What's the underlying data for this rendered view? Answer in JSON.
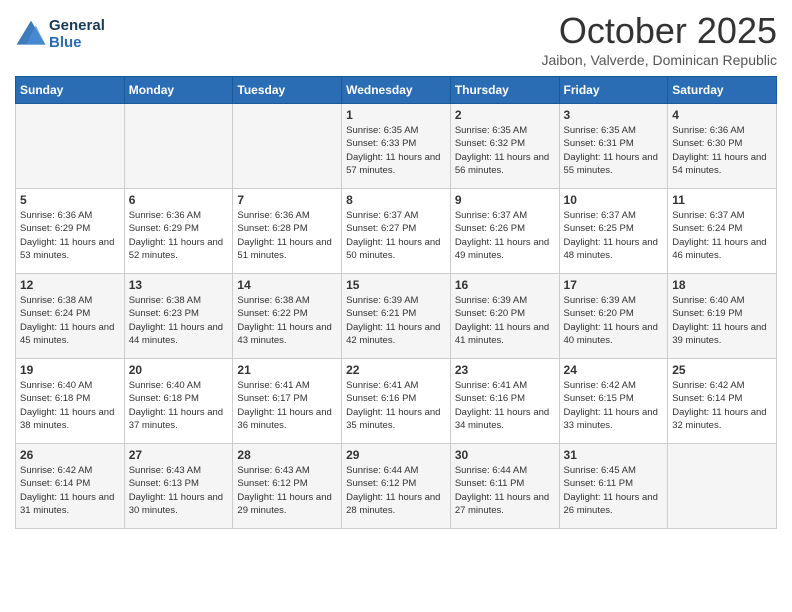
{
  "logo": {
    "line1": "General",
    "line2": "Blue"
  },
  "title": "October 2025",
  "location": "Jaibon, Valverde, Dominican Republic",
  "days_of_week": [
    "Sunday",
    "Monday",
    "Tuesday",
    "Wednesday",
    "Thursday",
    "Friday",
    "Saturday"
  ],
  "weeks": [
    [
      {
        "day": "",
        "sunrise": "",
        "sunset": "",
        "daylight": ""
      },
      {
        "day": "",
        "sunrise": "",
        "sunset": "",
        "daylight": ""
      },
      {
        "day": "",
        "sunrise": "",
        "sunset": "",
        "daylight": ""
      },
      {
        "day": "1",
        "sunrise": "Sunrise: 6:35 AM",
        "sunset": "Sunset: 6:33 PM",
        "daylight": "Daylight: 11 hours and 57 minutes."
      },
      {
        "day": "2",
        "sunrise": "Sunrise: 6:35 AM",
        "sunset": "Sunset: 6:32 PM",
        "daylight": "Daylight: 11 hours and 56 minutes."
      },
      {
        "day": "3",
        "sunrise": "Sunrise: 6:35 AM",
        "sunset": "Sunset: 6:31 PM",
        "daylight": "Daylight: 11 hours and 55 minutes."
      },
      {
        "day": "4",
        "sunrise": "Sunrise: 6:36 AM",
        "sunset": "Sunset: 6:30 PM",
        "daylight": "Daylight: 11 hours and 54 minutes."
      }
    ],
    [
      {
        "day": "5",
        "sunrise": "Sunrise: 6:36 AM",
        "sunset": "Sunset: 6:29 PM",
        "daylight": "Daylight: 11 hours and 53 minutes."
      },
      {
        "day": "6",
        "sunrise": "Sunrise: 6:36 AM",
        "sunset": "Sunset: 6:29 PM",
        "daylight": "Daylight: 11 hours and 52 minutes."
      },
      {
        "day": "7",
        "sunrise": "Sunrise: 6:36 AM",
        "sunset": "Sunset: 6:28 PM",
        "daylight": "Daylight: 11 hours and 51 minutes."
      },
      {
        "day": "8",
        "sunrise": "Sunrise: 6:37 AM",
        "sunset": "Sunset: 6:27 PM",
        "daylight": "Daylight: 11 hours and 50 minutes."
      },
      {
        "day": "9",
        "sunrise": "Sunrise: 6:37 AM",
        "sunset": "Sunset: 6:26 PM",
        "daylight": "Daylight: 11 hours and 49 minutes."
      },
      {
        "day": "10",
        "sunrise": "Sunrise: 6:37 AM",
        "sunset": "Sunset: 6:25 PM",
        "daylight": "Daylight: 11 hours and 48 minutes."
      },
      {
        "day": "11",
        "sunrise": "Sunrise: 6:37 AM",
        "sunset": "Sunset: 6:24 PM",
        "daylight": "Daylight: 11 hours and 46 minutes."
      }
    ],
    [
      {
        "day": "12",
        "sunrise": "Sunrise: 6:38 AM",
        "sunset": "Sunset: 6:24 PM",
        "daylight": "Daylight: 11 hours and 45 minutes."
      },
      {
        "day": "13",
        "sunrise": "Sunrise: 6:38 AM",
        "sunset": "Sunset: 6:23 PM",
        "daylight": "Daylight: 11 hours and 44 minutes."
      },
      {
        "day": "14",
        "sunrise": "Sunrise: 6:38 AM",
        "sunset": "Sunset: 6:22 PM",
        "daylight": "Daylight: 11 hours and 43 minutes."
      },
      {
        "day": "15",
        "sunrise": "Sunrise: 6:39 AM",
        "sunset": "Sunset: 6:21 PM",
        "daylight": "Daylight: 11 hours and 42 minutes."
      },
      {
        "day": "16",
        "sunrise": "Sunrise: 6:39 AM",
        "sunset": "Sunset: 6:20 PM",
        "daylight": "Daylight: 11 hours and 41 minutes."
      },
      {
        "day": "17",
        "sunrise": "Sunrise: 6:39 AM",
        "sunset": "Sunset: 6:20 PM",
        "daylight": "Daylight: 11 hours and 40 minutes."
      },
      {
        "day": "18",
        "sunrise": "Sunrise: 6:40 AM",
        "sunset": "Sunset: 6:19 PM",
        "daylight": "Daylight: 11 hours and 39 minutes."
      }
    ],
    [
      {
        "day": "19",
        "sunrise": "Sunrise: 6:40 AM",
        "sunset": "Sunset: 6:18 PM",
        "daylight": "Daylight: 11 hours and 38 minutes."
      },
      {
        "day": "20",
        "sunrise": "Sunrise: 6:40 AM",
        "sunset": "Sunset: 6:18 PM",
        "daylight": "Daylight: 11 hours and 37 minutes."
      },
      {
        "day": "21",
        "sunrise": "Sunrise: 6:41 AM",
        "sunset": "Sunset: 6:17 PM",
        "daylight": "Daylight: 11 hours and 36 minutes."
      },
      {
        "day": "22",
        "sunrise": "Sunrise: 6:41 AM",
        "sunset": "Sunset: 6:16 PM",
        "daylight": "Daylight: 11 hours and 35 minutes."
      },
      {
        "day": "23",
        "sunrise": "Sunrise: 6:41 AM",
        "sunset": "Sunset: 6:16 PM",
        "daylight": "Daylight: 11 hours and 34 minutes."
      },
      {
        "day": "24",
        "sunrise": "Sunrise: 6:42 AM",
        "sunset": "Sunset: 6:15 PM",
        "daylight": "Daylight: 11 hours and 33 minutes."
      },
      {
        "day": "25",
        "sunrise": "Sunrise: 6:42 AM",
        "sunset": "Sunset: 6:14 PM",
        "daylight": "Daylight: 11 hours and 32 minutes."
      }
    ],
    [
      {
        "day": "26",
        "sunrise": "Sunrise: 6:42 AM",
        "sunset": "Sunset: 6:14 PM",
        "daylight": "Daylight: 11 hours and 31 minutes."
      },
      {
        "day": "27",
        "sunrise": "Sunrise: 6:43 AM",
        "sunset": "Sunset: 6:13 PM",
        "daylight": "Daylight: 11 hours and 30 minutes."
      },
      {
        "day": "28",
        "sunrise": "Sunrise: 6:43 AM",
        "sunset": "Sunset: 6:12 PM",
        "daylight": "Daylight: 11 hours and 29 minutes."
      },
      {
        "day": "29",
        "sunrise": "Sunrise: 6:44 AM",
        "sunset": "Sunset: 6:12 PM",
        "daylight": "Daylight: 11 hours and 28 minutes."
      },
      {
        "day": "30",
        "sunrise": "Sunrise: 6:44 AM",
        "sunset": "Sunset: 6:11 PM",
        "daylight": "Daylight: 11 hours and 27 minutes."
      },
      {
        "day": "31",
        "sunrise": "Sunrise: 6:45 AM",
        "sunset": "Sunset: 6:11 PM",
        "daylight": "Daylight: 11 hours and 26 minutes."
      },
      {
        "day": "",
        "sunrise": "",
        "sunset": "",
        "daylight": ""
      }
    ]
  ]
}
